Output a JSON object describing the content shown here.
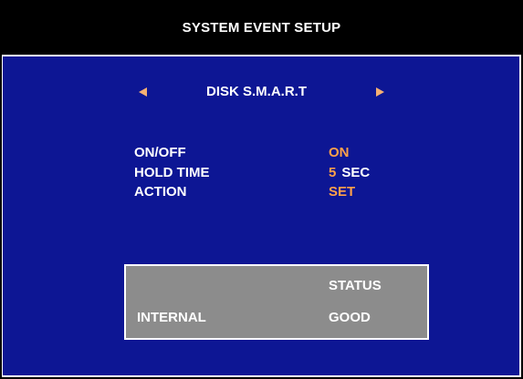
{
  "title": "SYSTEM EVENT  SETUP",
  "event": {
    "name": "DISK S.M.A.R.T",
    "prev_icon": "triangle-left-icon",
    "next_icon": "triangle-right-icon"
  },
  "settings": [
    {
      "label": "ON/OFF",
      "value": "ON",
      "unit": ""
    },
    {
      "label": "HOLD TIME",
      "value": "5",
      "unit": "SEC"
    },
    {
      "label": "ACTION",
      "value": "SET",
      "unit": ""
    }
  ],
  "status": {
    "header": "STATUS",
    "rows": [
      {
        "label": "INTERNAL",
        "value": "GOOD"
      }
    ]
  },
  "colors": {
    "background": "#0d1694",
    "title_bar": "#000000",
    "accent": "#ffa14a",
    "arrow": "#f5b073",
    "status_box": "#8c8c8c",
    "text": "#ffffff"
  }
}
